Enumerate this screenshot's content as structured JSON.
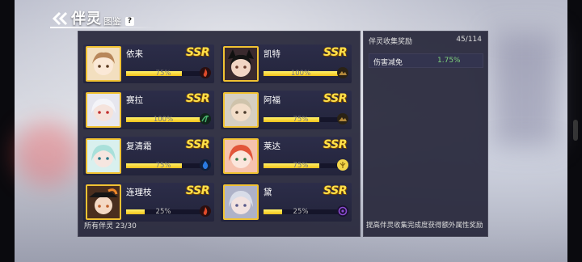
{
  "header": {
    "title": "伴灵",
    "subtitle": "图鉴",
    "help": "?"
  },
  "companions": [
    {
      "name": "依来",
      "rarity": "SSR",
      "progress": 0.75,
      "progress_label": "75%",
      "element": "fire-element-icon",
      "element_color": "#e04a2a"
    },
    {
      "name": "凯特",
      "rarity": "SSR",
      "progress": 1.0,
      "progress_label": "100%",
      "element": "earth-element-icon",
      "element_color": "#b48a3c"
    },
    {
      "name": "赛拉",
      "rarity": "SSR",
      "progress": 1.0,
      "progress_label": "100%",
      "element": "wind-element-icon",
      "element_color": "#49b36e"
    },
    {
      "name": "阿福",
      "rarity": "SSR",
      "progress": 0.75,
      "progress_label": "75%",
      "element": "earth-element-icon",
      "element_color": "#b48a3c"
    },
    {
      "name": "复清霜",
      "rarity": "SSR",
      "progress": 0.75,
      "progress_label": "75%",
      "element": "water-element-icon",
      "element_color": "#2a7be0"
    },
    {
      "name": "莱达",
      "rarity": "SSR",
      "progress": 0.75,
      "progress_label": "75%",
      "element": "light-element-icon",
      "element_color": "#f3d54a"
    },
    {
      "name": "连理枝",
      "rarity": "SSR",
      "progress": 0.25,
      "progress_label": "25%",
      "element": "fire-element-icon",
      "element_color": "#e04a2a"
    },
    {
      "name": "黛",
      "rarity": "SSR",
      "progress": 0.25,
      "progress_label": "25%",
      "element": "dark-element-icon",
      "element_color": "#8a4bd1"
    }
  ],
  "footer": {
    "count_label": "所有伴灵 23/30"
  },
  "reward_panel": {
    "title": "伴灵收集奖励",
    "count": "45/114",
    "rows": [
      {
        "label": "伤害减免",
        "value": "1.75%"
      }
    ],
    "footer": "提高伴灵收集完成度获得额外属性奖励"
  },
  "colors": {
    "rarity": "#ffe14a",
    "progress": "#f2c11a",
    "bonus_value": "#7fd27c",
    "avatar_border": "#f1c232"
  }
}
